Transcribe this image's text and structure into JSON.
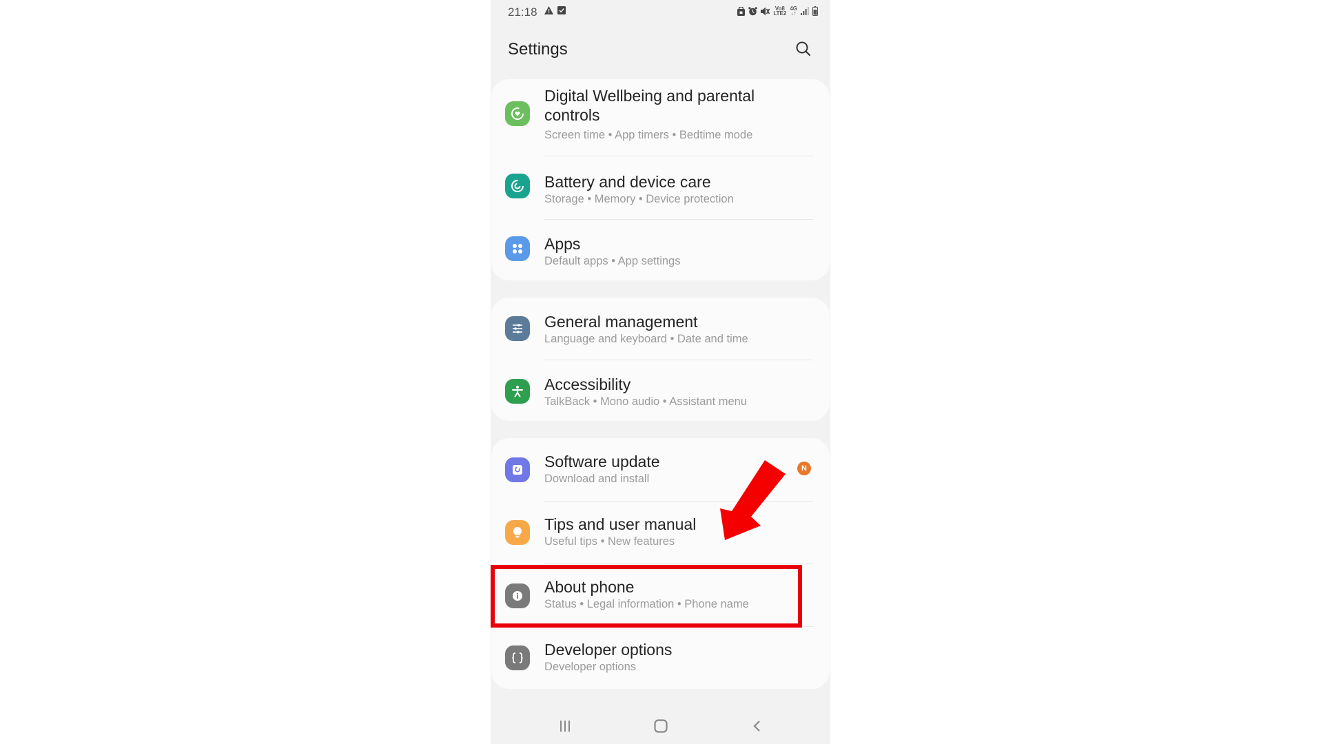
{
  "status_bar": {
    "time": "21:18",
    "left_icons": [
      "warning-icon",
      "checkbox-icon"
    ],
    "right_icons": [
      "sim-lock-icon",
      "alarm-icon",
      "mute-icon",
      "volte-icon",
      "network-4g-icon",
      "signal-icon",
      "battery-icon"
    ],
    "volte_label_top": "Vo8",
    "volte_label_bottom": "LTE2",
    "net_label_top": "4G",
    "net_label_bottom": "↓↑"
  },
  "header": {
    "title": "Settings",
    "search_icon": "search-icon"
  },
  "groups": [
    {
      "items": [
        {
          "title": "Digital Wellbeing and parental controls",
          "subtitle": "Screen time  •  App timers  •  Bedtime mode",
          "icon": "digital-wellbeing-icon",
          "color": "#6cbf5e"
        },
        {
          "title": "Battery and device care",
          "subtitle": "Storage  •  Memory  •  Device protection",
          "icon": "device-care-icon",
          "color": "#1aa38f"
        },
        {
          "title": "Apps",
          "subtitle": "Default apps  •  App settings",
          "icon": "apps-icon",
          "color": "#5b9ae8"
        }
      ]
    },
    {
      "items": [
        {
          "title": "General management",
          "subtitle": "Language and keyboard  •  Date and time",
          "icon": "sliders-icon",
          "color": "#5c7b99"
        },
        {
          "title": "Accessibility",
          "subtitle": "TalkBack  •  Mono audio  •  Assistant menu",
          "icon": "accessibility-icon",
          "color": "#2e9e4f"
        }
      ]
    },
    {
      "items": [
        {
          "title": "Software update",
          "subtitle": "Download and install",
          "icon": "software-update-icon",
          "color": "#6f78e6",
          "badge": "N"
        },
        {
          "title": "Tips and user manual",
          "subtitle": "Useful tips  •  New features",
          "icon": "lightbulb-icon",
          "color": "#f7a94a"
        },
        {
          "title": "About phone",
          "subtitle": "Status  •  Legal information  •  Phone name",
          "icon": "info-icon",
          "color": "#7a7a7a",
          "highlighted": true
        },
        {
          "title": "Developer options",
          "subtitle": "Developer options",
          "icon": "braces-icon",
          "color": "#7a7a7a"
        }
      ]
    }
  ],
  "annotation": {
    "highlight_color": "#e8000b",
    "arrow_color": "#f50000",
    "highlight_target": "About phone"
  },
  "nav_bar": {
    "buttons": [
      "recents-icon",
      "home-icon",
      "back-icon"
    ]
  },
  "colors": {
    "background": "#f2f2f2",
    "card": "#fbfbfb",
    "badge": "#e8782a"
  }
}
